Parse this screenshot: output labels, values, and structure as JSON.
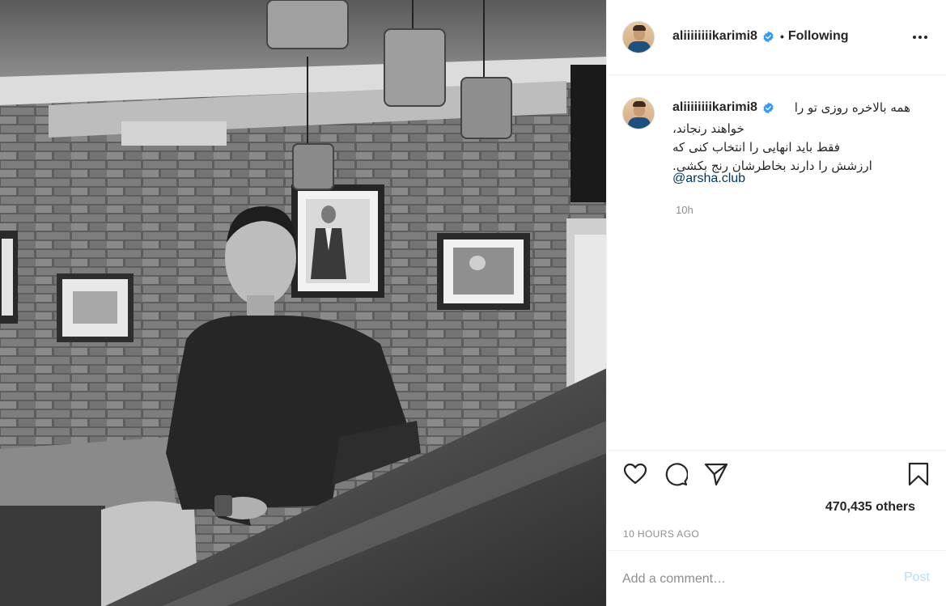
{
  "post": {
    "username": "aliiiiiiiikarimi8",
    "verified": true,
    "follow_status": "Following",
    "separator": "•",
    "caption": {
      "line1": "همه بالاخره روزی تو را",
      "line2": "خواهند رنجاند،",
      "line3": "فقط باید انهایی را انتخاب کنی که",
      "line4": "ارزشش را دارند بخاطرشان رنج بکشی.",
      "mention": "@arsha.club"
    },
    "caption_time": "10h",
    "likes_text": "470,435 others",
    "posted_ago": "10 HOURS AGO",
    "comment": {
      "placeholder": "Add a comment…",
      "post_label": "Post"
    }
  },
  "icons": {
    "verified": "verified-badge-icon",
    "more": "more-options-icon",
    "like": "heart-icon",
    "comment": "comment-bubble-icon",
    "share": "paper-plane-icon",
    "save": "bookmark-icon"
  },
  "colors": {
    "verified_blue": "#3897f0",
    "link": "#00376b",
    "muted": "#8e8e8e",
    "post_disabled": "#b2dffc",
    "border": "#efefef"
  }
}
